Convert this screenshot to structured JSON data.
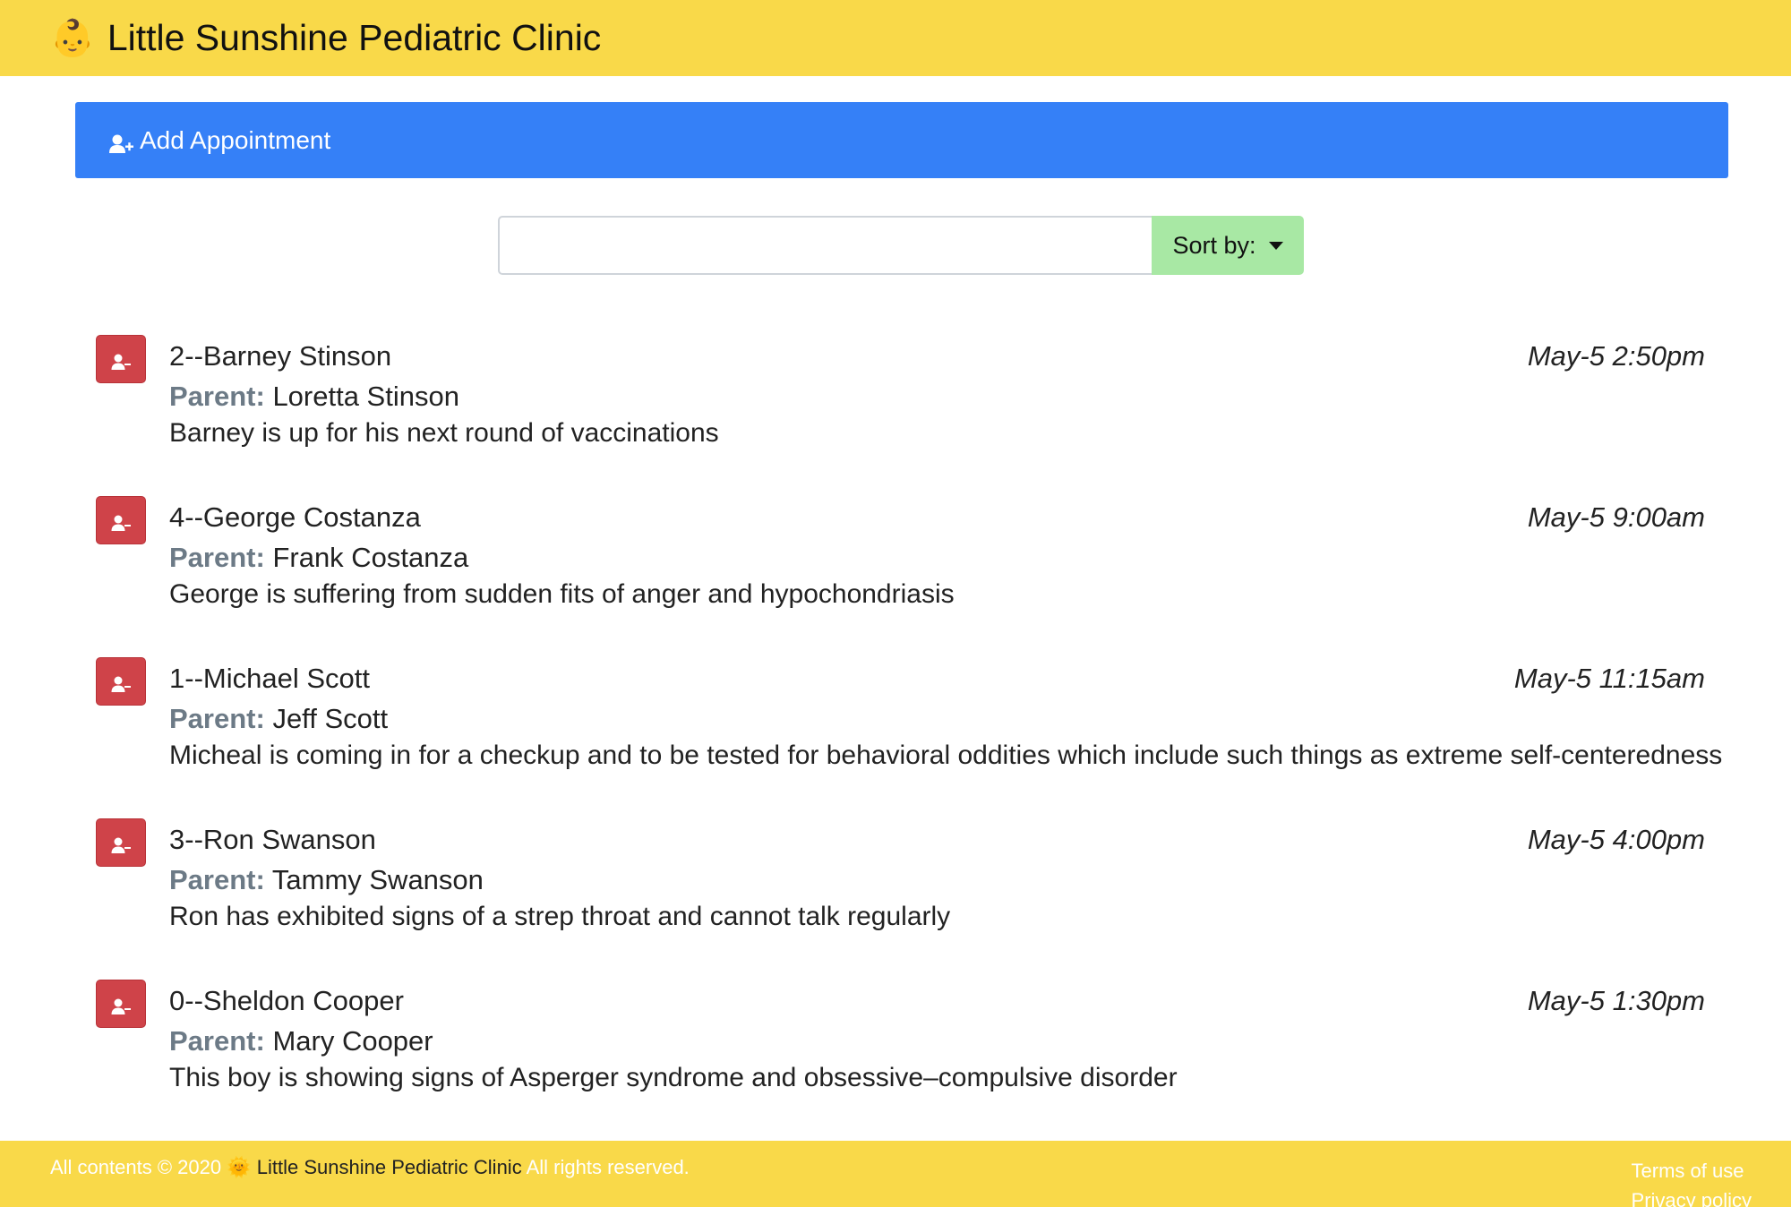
{
  "header": {
    "logo_emoji": "👶",
    "title": "Little Sunshine Pediatric Clinic"
  },
  "add_appointment": {
    "label": "Add Appointment",
    "icon": "user-plus-icon"
  },
  "search": {
    "value": "",
    "placeholder": ""
  },
  "sort": {
    "label": "Sort by:"
  },
  "owner_label": "Parent:",
  "appointments": [
    {
      "pet_name": "2--Barney Stinson",
      "date": "May-5 2:50pm",
      "owner": "Loretta Stinson",
      "notes": "Barney is up for his next round of vaccinations"
    },
    {
      "pet_name": "4--George Costanza",
      "date": "May-5 9:00am",
      "owner": "Frank Costanza",
      "notes": "George is suffering from sudden fits of anger and hypochondriasis"
    },
    {
      "pet_name": "1--Michael Scott",
      "date": "May-5 11:15am",
      "owner": "Jeff Scott",
      "notes": "Micheal is coming in for a checkup and to be tested for behavioral oddities which include such things as extreme self-centeredness"
    },
    {
      "pet_name": "3--Ron Swanson",
      "date": "May-5 4:00pm",
      "owner": "Tammy Swanson",
      "notes": "Ron has exhibited signs of a strep throat and cannot talk regularly"
    },
    {
      "pet_name": "0--Sheldon Cooper",
      "date": "May-5 1:30pm",
      "owner": "Mary Cooper",
      "notes": "This boy is showing signs of Asperger syndrome and obsessive–compulsive disorder"
    }
  ],
  "footer": {
    "prefix": "All contents © 2020",
    "sun_emoji": "🌞",
    "brand": "Little Sunshine Pediatric Clinic",
    "suffix": "All rights reserved.",
    "terms": "Terms of use",
    "privacy": "Privacy policy"
  },
  "colors": {
    "header_bg": "#f9d949",
    "add_bar_bg": "#3580f7",
    "sort_bg": "#a8e8a4",
    "delete_bg": "#cf4349",
    "owner_label": "#6c7a86"
  }
}
